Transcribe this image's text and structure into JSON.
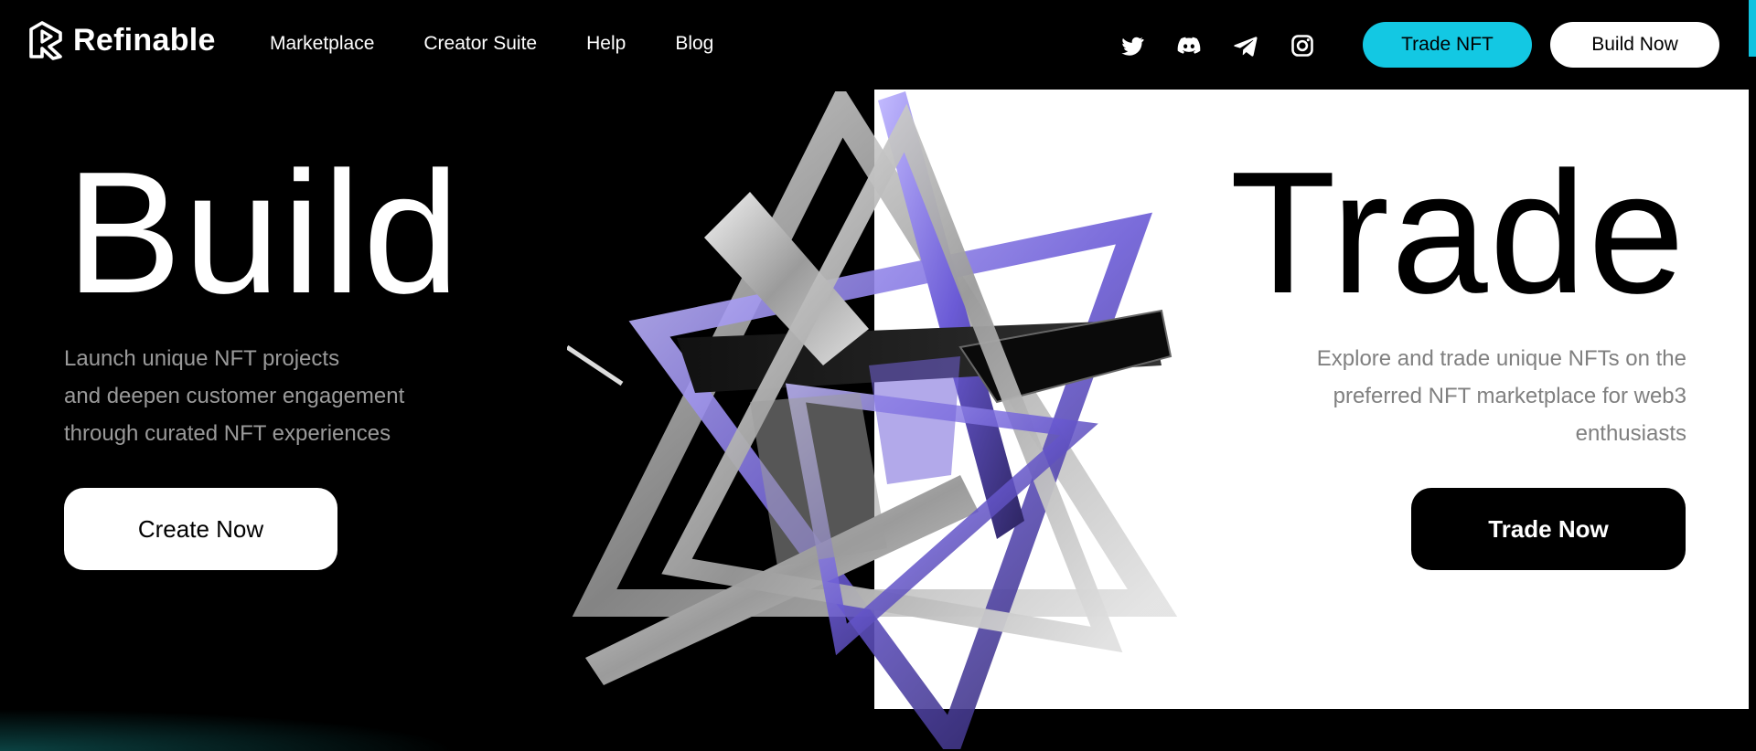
{
  "header": {
    "brand": "Refinable",
    "nav": [
      "Marketplace",
      "Creator Suite",
      "Help",
      "Blog"
    ],
    "socials": [
      "twitter-icon",
      "discord-icon",
      "telegram-icon",
      "instagram-icon"
    ],
    "trade_nft_label": "Trade NFT",
    "build_now_label": "Build Now"
  },
  "hero": {
    "build": {
      "title": "Build",
      "lines": [
        "Launch unique NFT projects",
        "and deepen customer engagement",
        "through curated NFT experiences"
      ],
      "button": "Create Now"
    },
    "trade": {
      "title": "Trade",
      "lines": [
        "Explore and trade unique NFTs on the",
        "preferred NFT marketplace for web3",
        "enthusiasts"
      ],
      "button": "Trade Now"
    }
  },
  "colors": {
    "accent": "#13c8e3",
    "background": "#000000",
    "panel": "#ffffff",
    "art_purple": "#8a7ce8",
    "art_silver": "#c8c8c8"
  }
}
